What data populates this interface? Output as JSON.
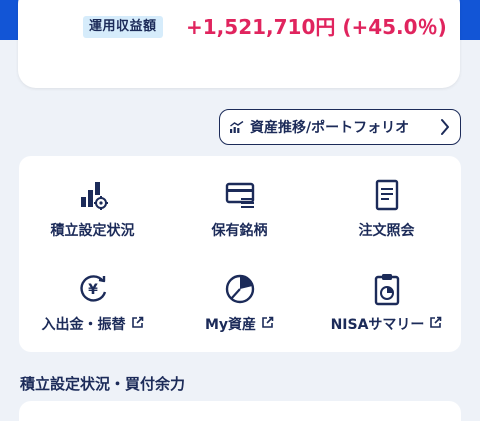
{
  "summary": {
    "profit_label": "運用収益額",
    "profit_value": "+1,521,710円 (+45.0％)",
    "profit_color": "#e0245e"
  },
  "asset_button": {
    "label": "資産推移/ポートフォリオ",
    "icon": "chart-icon"
  },
  "menu": {
    "items": [
      {
        "label": "積立設定状況",
        "icon": "bar-chart-gear-icon",
        "external": false
      },
      {
        "label": "保有銘柄",
        "icon": "card-list-icon",
        "external": false
      },
      {
        "label": "注文照会",
        "icon": "document-icon",
        "external": false
      },
      {
        "label": "入出金・振替",
        "icon": "yen-transfer-icon",
        "external": true
      },
      {
        "label": "My資産",
        "icon": "pie-chart-icon",
        "external": true
      },
      {
        "label": "NISAサマリー",
        "icon": "clipboard-chart-icon",
        "external": true
      }
    ]
  },
  "section": {
    "title": "積立設定状況・買付余力"
  },
  "colors": {
    "brand": "#1255d6",
    "text": "#1c2b59",
    "background": "#eef2f8"
  }
}
